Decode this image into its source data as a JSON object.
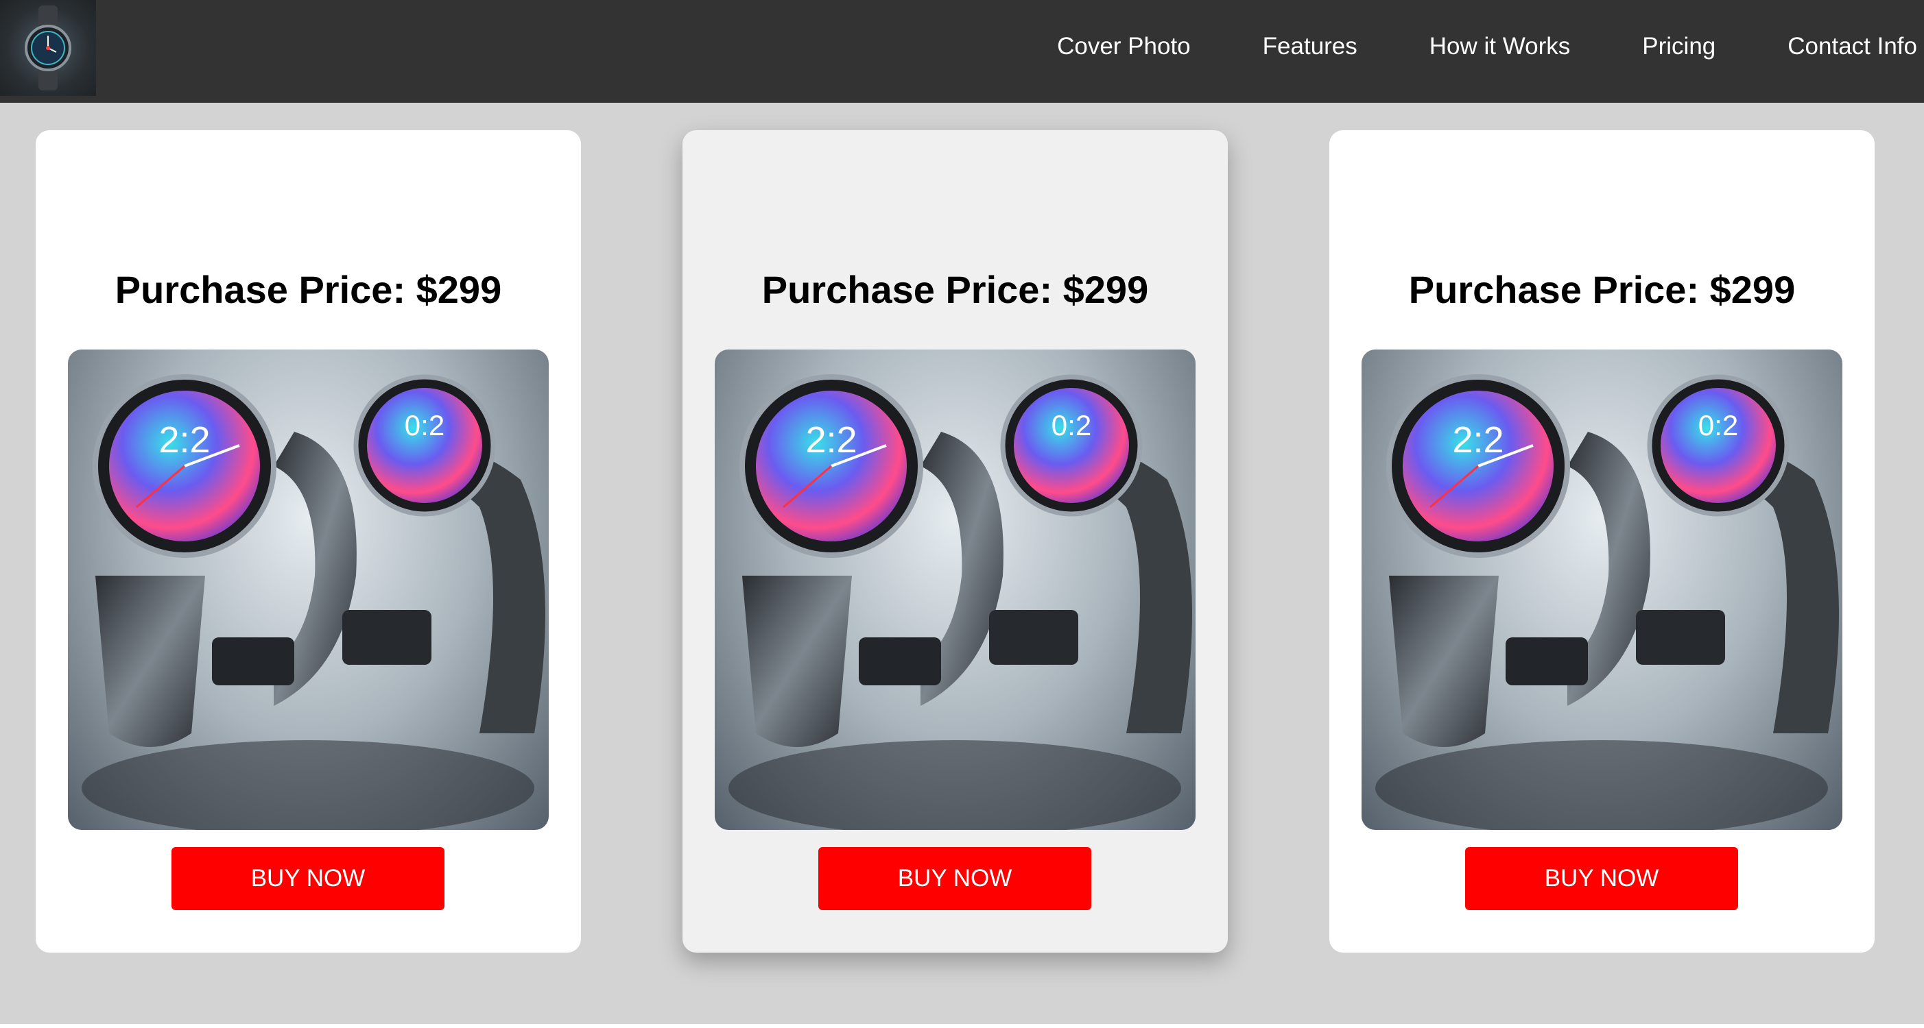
{
  "header": {
    "logo_icon": "smartwatch-logo-icon",
    "nav": [
      {
        "label": "Cover Photo"
      },
      {
        "label": "Features"
      },
      {
        "label": "How it Works"
      },
      {
        "label": "Pricing"
      },
      {
        "label": "Contact Info"
      }
    ]
  },
  "pricing": {
    "cards": [
      {
        "title": "Purchase Price: $299",
        "image": "smartwatch-pair-image",
        "button_label": "BUY NOW"
      },
      {
        "title": "Purchase Price: $299",
        "image": "smartwatch-pair-image",
        "button_label": "BUY NOW"
      },
      {
        "title": "Purchase Price: $299",
        "image": "smartwatch-pair-image",
        "button_label": "BUY NOW"
      }
    ]
  },
  "colors": {
    "navbar": "#333333",
    "page_background": "#d3d3d3",
    "card_background": "#ffffff",
    "featured_card_background": "#f0f0f0",
    "button": "#ff0000",
    "button_text": "#ffffff"
  }
}
